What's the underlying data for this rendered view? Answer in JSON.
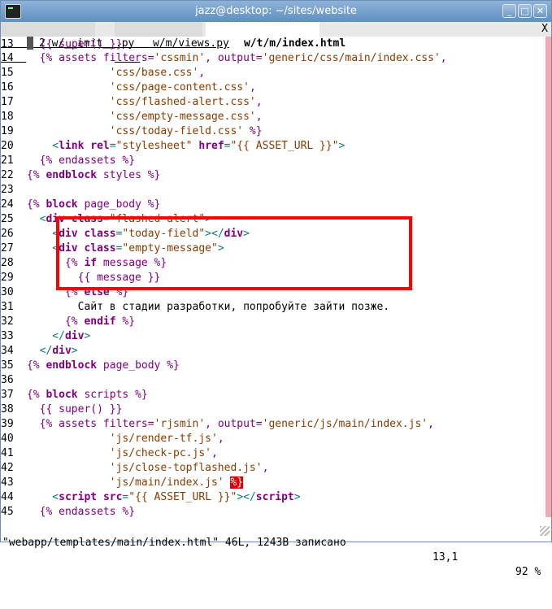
{
  "window": {
    "title": "jazz@desktop: ~/sites/website",
    "buttons": {
      "minimize": "_",
      "maximize": "□",
      "close": "✕"
    }
  },
  "tabs": [
    {
      "num": "2",
      "label": " w/__init__.py",
      "active": false
    },
    {
      "num": "",
      "label": "w/m/views.py",
      "active": false
    },
    {
      "num": "",
      "label": "w/t/m/index.html",
      "active": true
    }
  ],
  "tab_close": "X",
  "lines": [
    {
      "n": "13",
      "parts": [
        {
          "c": "cursor",
          "t": ""
        },
        {
          "c": "kw",
          "t": " {{ super() }}"
        }
      ]
    },
    {
      "n": "14",
      "parts": [
        {
          "c": "kw",
          "t": "  {% assets filters="
        },
        {
          "c": "st",
          "t": "'cssmin'"
        },
        {
          "c": "kw",
          "t": ", output="
        },
        {
          "c": "st",
          "t": "'generic/css/main/index.css'"
        },
        {
          "c": "kw",
          "t": ","
        }
      ]
    },
    {
      "n": "15",
      "parts": [
        {
          "c": "st",
          "t": "             'css/base.css'"
        },
        {
          "c": "kw",
          "t": ","
        }
      ]
    },
    {
      "n": "16",
      "parts": [
        {
          "c": "st",
          "t": "             'css/page-content.css'"
        },
        {
          "c": "kw",
          "t": ","
        }
      ]
    },
    {
      "n": "17",
      "parts": [
        {
          "c": "st",
          "t": "             'css/flashed-alert.css'"
        },
        {
          "c": "kw",
          "t": ","
        }
      ]
    },
    {
      "n": "18",
      "parts": [
        {
          "c": "st",
          "t": "             'css/empty-message.css'"
        },
        {
          "c": "kw",
          "t": ","
        }
      ]
    },
    {
      "n": "19",
      "parts": [
        {
          "c": "st",
          "t": "             'css/today-field.css'"
        },
        {
          "c": "kw",
          "t": " %}"
        }
      ]
    },
    {
      "n": "20",
      "parts": [
        {
          "c": "tg",
          "t": "    <"
        },
        {
          "c": "bk",
          "t": "link"
        },
        {
          "c": "tg",
          "t": " "
        },
        {
          "c": "bk",
          "t": "rel"
        },
        {
          "c": "tg",
          "t": "="
        },
        {
          "c": "st",
          "t": "\"stylesheet\""
        },
        {
          "c": "tg",
          "t": " "
        },
        {
          "c": "bk",
          "t": "href"
        },
        {
          "c": "tg",
          "t": "="
        },
        {
          "c": "st",
          "t": "\"{{ ASSET_URL }}\""
        },
        {
          "c": "tg",
          "t": ">"
        }
      ]
    },
    {
      "n": "21",
      "parts": [
        {
          "c": "kw",
          "t": "  {% endassets %}"
        }
      ]
    },
    {
      "n": "22",
      "parts": [
        {
          "c": "kw",
          "t": "{% "
        },
        {
          "c": "bk",
          "t": "endblock"
        },
        {
          "c": "kw",
          "t": " styles %}"
        }
      ]
    },
    {
      "n": "23",
      "parts": []
    },
    {
      "n": "24",
      "parts": [
        {
          "c": "kw",
          "t": "{% "
        },
        {
          "c": "bk",
          "t": "block"
        },
        {
          "c": "kw",
          "t": " page_body %}"
        }
      ]
    },
    {
      "n": "25",
      "parts": [
        {
          "c": "tg",
          "t": "  <"
        },
        {
          "c": "bk",
          "t": "div"
        },
        {
          "c": "tg",
          "t": " "
        },
        {
          "c": "bk",
          "t": "class"
        },
        {
          "c": "tg",
          "t": "="
        },
        {
          "c": "st",
          "t": "\"flashed-alert\""
        },
        {
          "c": "tg",
          "t": ">"
        }
      ]
    },
    {
      "n": "26",
      "parts": [
        {
          "c": "tg",
          "t": "    <"
        },
        {
          "c": "bk",
          "t": "div"
        },
        {
          "c": "tg",
          "t": " "
        },
        {
          "c": "bk",
          "t": "class"
        },
        {
          "c": "tg",
          "t": "="
        },
        {
          "c": "st",
          "t": "\"today-field\""
        },
        {
          "c": "tg",
          "t": "></"
        },
        {
          "c": "bk",
          "t": "div"
        },
        {
          "c": "tg",
          "t": ">"
        }
      ]
    },
    {
      "n": "27",
      "parts": [
        {
          "c": "tg",
          "t": "    <"
        },
        {
          "c": "bk",
          "t": "div"
        },
        {
          "c": "tg",
          "t": " "
        },
        {
          "c": "bk",
          "t": "class"
        },
        {
          "c": "tg",
          "t": "="
        },
        {
          "c": "st",
          "t": "\"empty-message\""
        },
        {
          "c": "tg",
          "t": ">"
        }
      ]
    },
    {
      "n": "28",
      "parts": [
        {
          "c": "kw",
          "t": "      {% "
        },
        {
          "c": "bk",
          "t": "if"
        },
        {
          "c": "kw",
          "t": " message %}"
        }
      ]
    },
    {
      "n": "29",
      "parts": [
        {
          "c": "kw",
          "t": "        {{ message }}"
        }
      ]
    },
    {
      "n": "30",
      "parts": [
        {
          "c": "kw",
          "t": "      {% "
        },
        {
          "c": "bk",
          "t": "else"
        },
        {
          "c": "kw",
          "t": " %}"
        }
      ]
    },
    {
      "n": "31",
      "parts": [
        {
          "c": "tx",
          "t": "        Сайт в стадии разработки, попробуйте зайти позже."
        }
      ]
    },
    {
      "n": "32",
      "parts": [
        {
          "c": "kw",
          "t": "      {% "
        },
        {
          "c": "bk",
          "t": "endif"
        },
        {
          "c": "kw",
          "t": " %}"
        }
      ]
    },
    {
      "n": "33",
      "parts": [
        {
          "c": "tg",
          "t": "    </"
        },
        {
          "c": "bk",
          "t": "div"
        },
        {
          "c": "tg",
          "t": ">"
        }
      ]
    },
    {
      "n": "34",
      "parts": [
        {
          "c": "tg",
          "t": "  </"
        },
        {
          "c": "bk",
          "t": "div"
        },
        {
          "c": "tg",
          "t": ">"
        }
      ]
    },
    {
      "n": "35",
      "parts": [
        {
          "c": "kw",
          "t": "{% "
        },
        {
          "c": "bk",
          "t": "endblock"
        },
        {
          "c": "kw",
          "t": " page_body %}"
        }
      ]
    },
    {
      "n": "36",
      "parts": []
    },
    {
      "n": "37",
      "parts": [
        {
          "c": "kw",
          "t": "{% "
        },
        {
          "c": "bk",
          "t": "block"
        },
        {
          "c": "kw",
          "t": " scripts %}"
        }
      ]
    },
    {
      "n": "38",
      "parts": [
        {
          "c": "kw",
          "t": "  {{ super() }}"
        }
      ]
    },
    {
      "n": "39",
      "parts": [
        {
          "c": "kw",
          "t": "  {% assets filters="
        },
        {
          "c": "st",
          "t": "'rjsmin'"
        },
        {
          "c": "kw",
          "t": ", output="
        },
        {
          "c": "st",
          "t": "'generic/js/main/index.js'"
        },
        {
          "c": "kw",
          "t": ","
        }
      ]
    },
    {
      "n": "40",
      "parts": [
        {
          "c": "st",
          "t": "             'js/render-tf.js'"
        },
        {
          "c": "kw",
          "t": ","
        }
      ]
    },
    {
      "n": "41",
      "parts": [
        {
          "c": "st",
          "t": "             'js/check-pc.js'"
        },
        {
          "c": "kw",
          "t": ","
        }
      ]
    },
    {
      "n": "42",
      "parts": [
        {
          "c": "st",
          "t": "             'js/close-topflashed.js'"
        },
        {
          "c": "kw",
          "t": ","
        }
      ]
    },
    {
      "n": "43",
      "parts": [
        {
          "c": "st",
          "t": "             'js/main/index.js'"
        },
        {
          "c": "kw",
          "t": " "
        },
        {
          "c": "errmark",
          "t": "%}"
        }
      ]
    },
    {
      "n": "44",
      "parts": [
        {
          "c": "tg",
          "t": "    <"
        },
        {
          "c": "bk",
          "t": "script"
        },
        {
          "c": "tg",
          "t": " "
        },
        {
          "c": "bk",
          "t": "src"
        },
        {
          "c": "tg",
          "t": "="
        },
        {
          "c": "st",
          "t": "\"{{ ASSET_URL }}\""
        },
        {
          "c": "tg",
          "t": "></"
        },
        {
          "c": "bk",
          "t": "script"
        },
        {
          "c": "tg",
          "t": ">"
        }
      ]
    },
    {
      "n": "45",
      "parts": [
        {
          "c": "kw",
          "t": "  {% endassets %}"
        }
      ]
    }
  ],
  "status": {
    "file": "\"webapp/templates/main/index.html\" 46L, 1243B записано",
    "position": "13,1",
    "percent": "92 %"
  }
}
